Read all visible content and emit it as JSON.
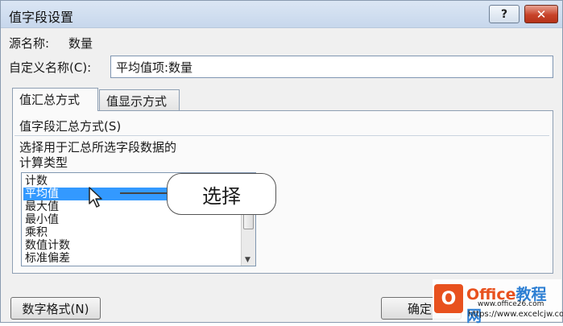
{
  "window": {
    "title": "值字段设置",
    "help_label": "?",
    "close_label": "✕"
  },
  "source": {
    "label": "源名称:",
    "value": "数量"
  },
  "custom_name": {
    "label": "自定义名称(C):",
    "value": "平均值项:数量"
  },
  "tabs": [
    {
      "label": "值汇总方式",
      "active": true
    },
    {
      "label": "值显示方式",
      "active": false
    }
  ],
  "panel": {
    "group_label": "值字段汇总方式(S)",
    "description_line1": "选择用于汇总所选字段数据的",
    "description_line2": "计算类型"
  },
  "summary_list": {
    "items": [
      "计数",
      "平均值",
      "最大值",
      "最小值",
      "乘积",
      "数值计数",
      "标准偏差"
    ],
    "selected": "平均值"
  },
  "callout": {
    "text": "选择"
  },
  "buttons": {
    "number_format": "数字格式(N)",
    "ok": "确定"
  },
  "watermark": {
    "office": "Office",
    "rest": "教程网",
    "url1": "www.office26.com",
    "url2": "https://www.excelcjw.com"
  },
  "colors": {
    "selection": "#3399ff",
    "close_button": "#c8432a",
    "titlebar": "#c7d7ec"
  }
}
